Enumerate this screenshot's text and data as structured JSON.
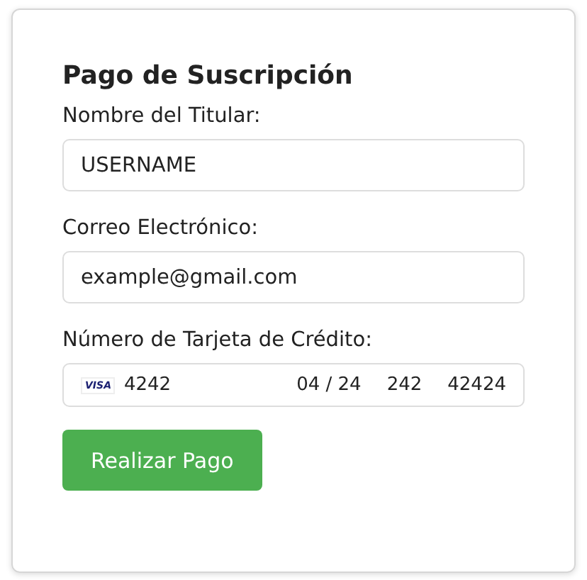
{
  "title": "Pago de Suscripción",
  "fields": [
    {
      "kind": "text",
      "label": "Nombre del Titular:",
      "value": "USERNAME"
    },
    {
      "kind": "text",
      "label": "Correo Electrónico:",
      "value": "example@gmail.com"
    },
    {
      "kind": "card",
      "label": "Número de Tarjeta de Crédito:",
      "brand": "VISA",
      "number": "4242",
      "expiry": "04 / 24",
      "cvc": "242",
      "postal": "42424"
    }
  ],
  "button": "Realizar Pago"
}
